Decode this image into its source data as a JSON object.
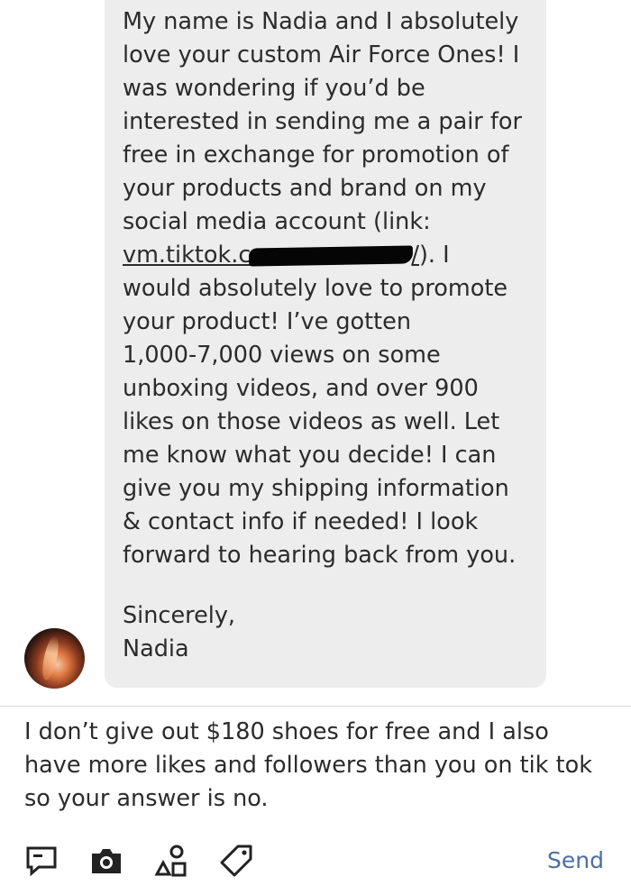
{
  "message": {
    "lines": [
      "My name is Nadia and I absolutely",
      "love your custom Air Force Ones! I",
      "was wondering if you’d be",
      "interested in sending me a pair for",
      "free in exchange for promotion of",
      "your products and brand on my",
      "social media account (link:",
      "",
      "would absolutely love to promote",
      "your product! I’ve gotten",
      "1,000-7,000 views on some",
      "unboxing videos, and over 900",
      "likes on those videos as well. Let",
      "me know what you decide! I can",
      "give you my shipping information",
      "& contact info if needed! I look",
      "forward to hearing back from you."
    ],
    "link_prefix": "vm.tiktok.c",
    "link_suffix": "/",
    "after_link": "). I",
    "signoff": "Sincerely,",
    "signature": "Nadia"
  },
  "reply": {
    "lines": [
      "I don’t give out $180 shoes for free and I also",
      "have more likes and followers than you on tik tok",
      "so your answer is no."
    ]
  },
  "toolbar": {
    "icons": [
      "message-icon",
      "camera-icon",
      "shapes-icon",
      "tag-icon"
    ],
    "send_label": "Send",
    "send_color": "#4b6fa3"
  }
}
